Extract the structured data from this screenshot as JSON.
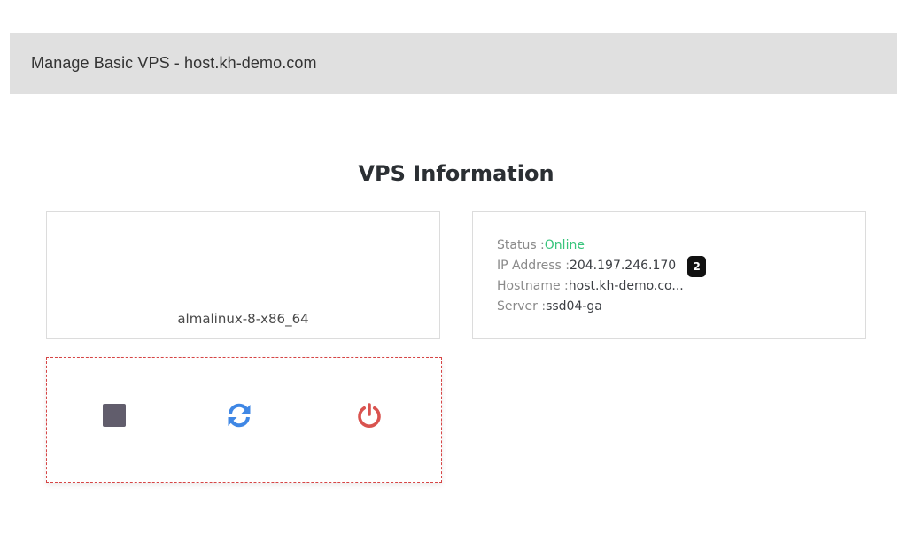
{
  "header": {
    "title": "Manage Basic VPS - host.kh-demo.com"
  },
  "section": {
    "title": "VPS Information"
  },
  "os_card": {
    "os_name": "almalinux-8-x86_64"
  },
  "info_card": {
    "status_label": "Status : ",
    "status_value": "Online",
    "ip_label": "IP Address : ",
    "ip_value": "204.197.246.170",
    "ip_badge": "2",
    "hostname_label": "Hostname :",
    "hostname_value": "host.kh-demo.co...",
    "server_label": "Server : ",
    "server_value": "ssd04-ga"
  },
  "controls": {
    "stop_icon": "stop-icon",
    "reboot_icon": "refresh-icon",
    "power_icon": "power-icon"
  },
  "colors": {
    "online": "#37c47b",
    "stop": "#615d6c",
    "reboot": "#3f87e5",
    "power": "#d9534f",
    "controls_border": "#d64545",
    "header_bg": "#e0e0e0"
  }
}
